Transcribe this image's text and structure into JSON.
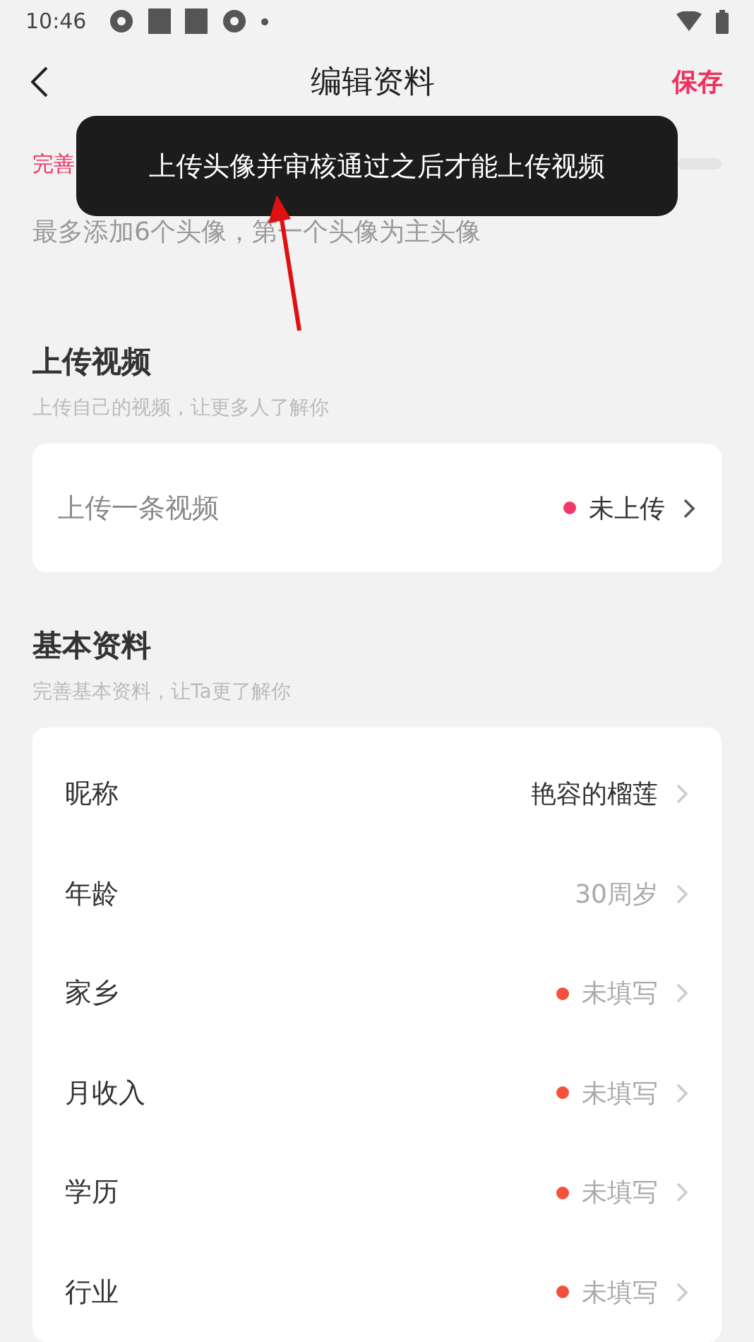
{
  "status_bar": {
    "time": "10:46"
  },
  "header": {
    "title": "编辑资料",
    "save": "保存"
  },
  "completeness": {
    "label": "完善"
  },
  "avatar_hint": "最多添加6个头像，第一个头像为主头像",
  "toast": "上传头像并审核通过之后才能上传视频",
  "video_section": {
    "title": "上传视频",
    "subtitle": "上传自己的视频，让更多人了解你",
    "row": {
      "label": "上传一条视频",
      "status": "未上传",
      "missing": true
    }
  },
  "basic_section": {
    "title": "基本资料",
    "subtitle": "完善基本资料，让Ta更了解你",
    "rows": [
      {
        "label": "昵称",
        "value": "艳容的榴莲",
        "kind": "name",
        "missing": false
      },
      {
        "label": "年龄",
        "value": "30周岁",
        "kind": "plain",
        "missing": false
      },
      {
        "label": "家乡",
        "value": "未填写",
        "kind": "plain",
        "missing": true
      },
      {
        "label": "月收入",
        "value": "未填写",
        "kind": "plain",
        "missing": true
      },
      {
        "label": "学历",
        "value": "未填写",
        "kind": "plain",
        "missing": true
      },
      {
        "label": "行业",
        "value": "未填写",
        "kind": "plain",
        "missing": true
      }
    ]
  }
}
